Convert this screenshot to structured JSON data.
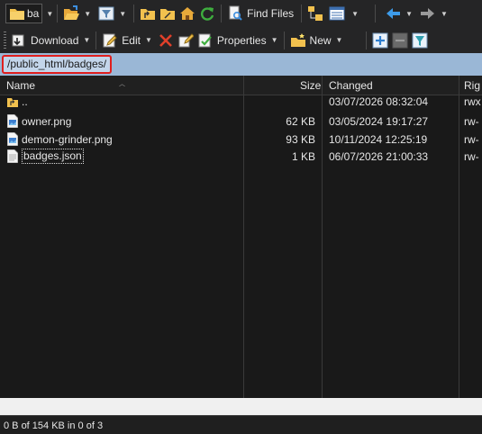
{
  "toolbar1": {
    "drive_combo_text": "ba",
    "find_files_label": "Find Files"
  },
  "toolbar2": {
    "download_label": "Download",
    "edit_label": "Edit",
    "properties_label": "Properties",
    "new_label": "New"
  },
  "path": {
    "current": "/public_html/badges/"
  },
  "columns": {
    "name": "Name",
    "size": "Size",
    "changed": "Changed",
    "rights": "Rig"
  },
  "files": [
    {
      "name": "..",
      "size": "",
      "changed": "03/07/2026 08:32:04",
      "rights": "rwx",
      "icon": "parent-folder-icon"
    },
    {
      "name": "owner.png",
      "size": "62 KB",
      "changed": "03/05/2024 19:17:27",
      "rights": "rw-",
      "icon": "image-file-icon"
    },
    {
      "name": "demon-grinder.png",
      "size": "93 KB",
      "changed": "10/11/2024 12:25:19",
      "rights": "rw-",
      "icon": "image-file-icon"
    },
    {
      "name": "badges.json",
      "size": "1 KB",
      "changed": "06/07/2026 21:00:33",
      "rights": "rw-",
      "icon": "text-file-icon"
    }
  ],
  "status": {
    "text": "0 B of 154 KB in 0 of 3"
  },
  "colors": {
    "path_bar": "#9ab7d6",
    "path_highlight": "#e01e1e",
    "folder": "#f2c14e",
    "refresh": "#3fae3f",
    "delete": "#e0402a"
  }
}
